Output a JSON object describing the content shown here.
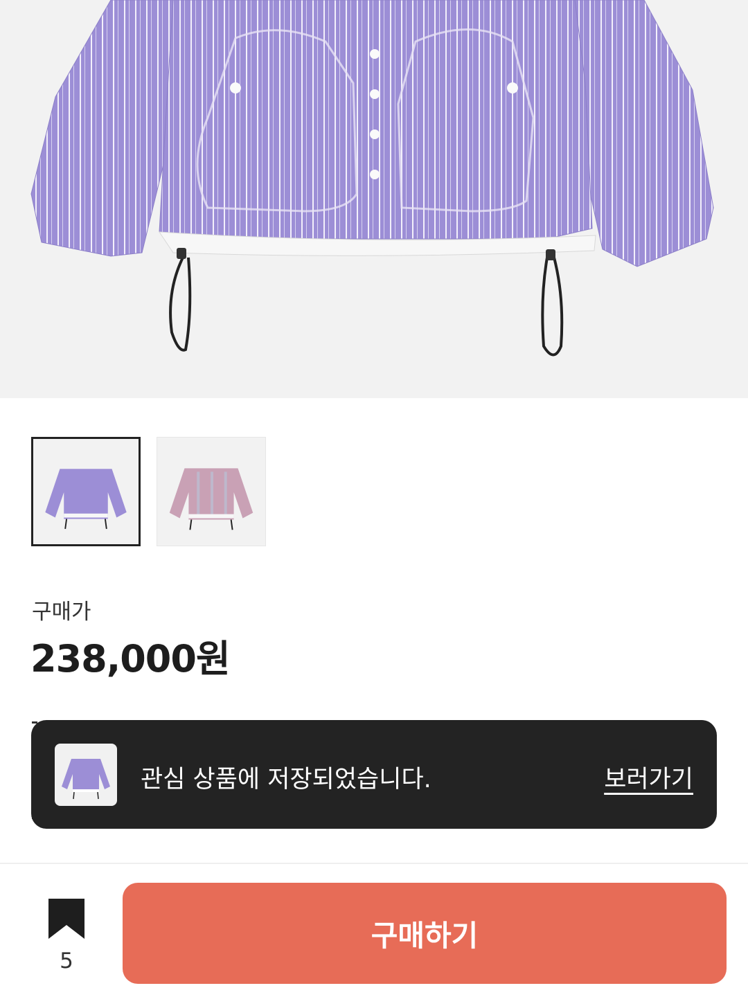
{
  "colors": {
    "accent": "#e76c57",
    "toast_bg": "#232323",
    "jacket_primary": "#9c8ed6",
    "jacket_secondary": "#c9a1b5"
  },
  "product": {
    "image_alt": "purple striped shirt jacket",
    "thumbnails": [
      {
        "color": "lavender stripe",
        "selected": true
      },
      {
        "color": "pink stripe",
        "selected": false
      }
    ],
    "price_label": "구매가",
    "price": "238,000원"
  },
  "toast": {
    "message": "관심 상품에 저장되었습니다.",
    "link": "보러가기"
  },
  "bottom_bar": {
    "bookmark_icon": "bookmark-icon",
    "bookmark_count": "5",
    "buy_label": "구매하기"
  }
}
